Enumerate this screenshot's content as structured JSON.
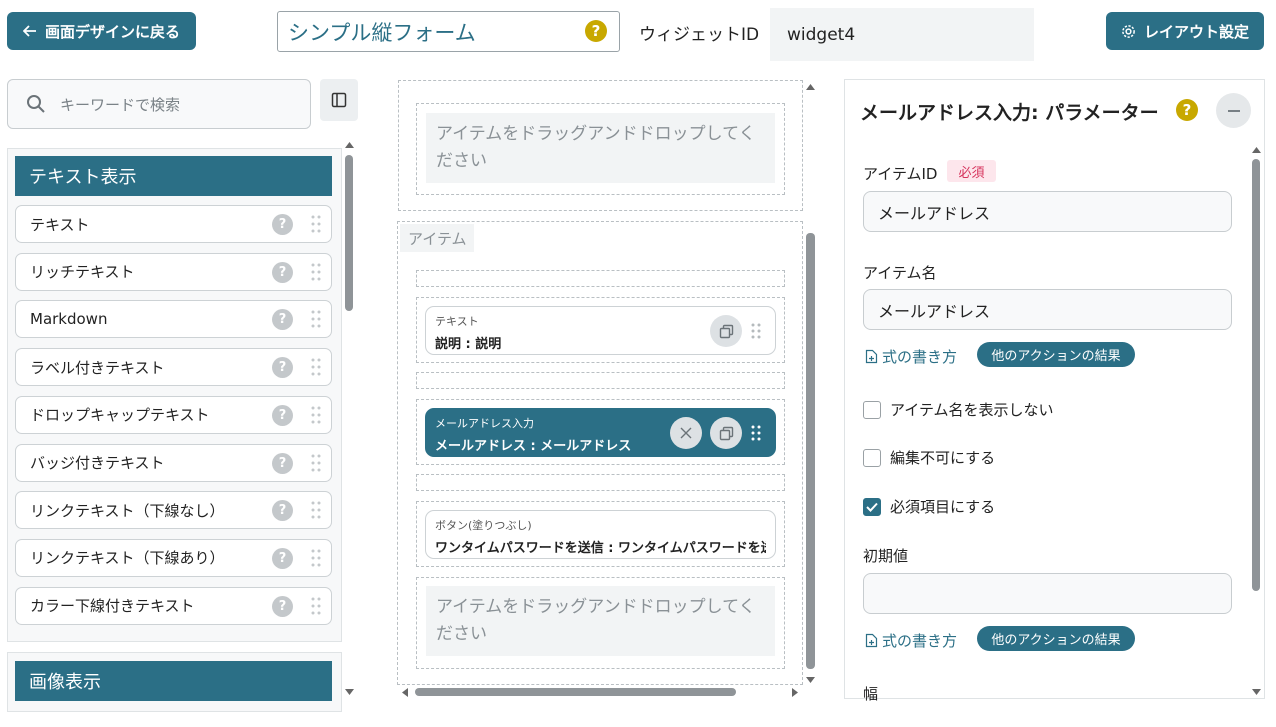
{
  "header": {
    "back_label": "画面デザインに戻る",
    "form_title": "シンプル縦フォーム",
    "widget_id_label": "ウィジェットID",
    "widget_id_value": "widget4",
    "layout_label": "レイアウト設定",
    "help_glyph": "?"
  },
  "palette": {
    "search_placeholder": "キーワードで検索",
    "categories": [
      {
        "title": "テキスト表示",
        "items": [
          "テキスト",
          "リッチテキスト",
          "Markdown",
          "ラベル付きテキスト",
          "ドロップキャップテキスト",
          "バッジ付きテキスト",
          "リンクテキスト（下線なし）",
          "リンクテキスト（下線あり）",
          "カラー下線付きテキスト"
        ]
      },
      {
        "title": "画像表示"
      }
    ],
    "help_glyph": "?"
  },
  "canvas": {
    "drop_placeholder": "アイテムをドラッグアンドドロップしてください",
    "section_label": "アイテム",
    "cards": [
      {
        "type": "テキスト",
        "summary": "説明 : 説明",
        "selected": false
      },
      {
        "type": "メールアドレス入力",
        "summary": "メールアドレス : メールアドレス",
        "selected": true
      },
      {
        "type": "ボタン(塗りつぶし)",
        "summary": "ワンタイムパスワードを送信 : ワンタイムパスワードを送信",
        "selected": false
      }
    ]
  },
  "params": {
    "title": "メールアドレス入力: パラメーター",
    "item_id_label": "アイテムID",
    "required_badge": "必須",
    "item_id_value": "メールアドレス",
    "item_name_label": "アイテム名",
    "item_name_value": "メールアドレス",
    "formula_link": "式の書き方",
    "other_action_pill": "他のアクションの結果",
    "hide_name_label": "アイテム名を表示しない",
    "readonly_label": "編集不可にする",
    "required_label": "必須項目にする",
    "checkbox_states": {
      "hide_name": false,
      "readonly": false,
      "required": true
    },
    "initial_value_label": "初期値",
    "initial_value": "",
    "width_label": "幅"
  },
  "colors": {
    "accent": "#2b6f86",
    "help_yellow": "#c8a800",
    "required_red": "#d6335c"
  }
}
